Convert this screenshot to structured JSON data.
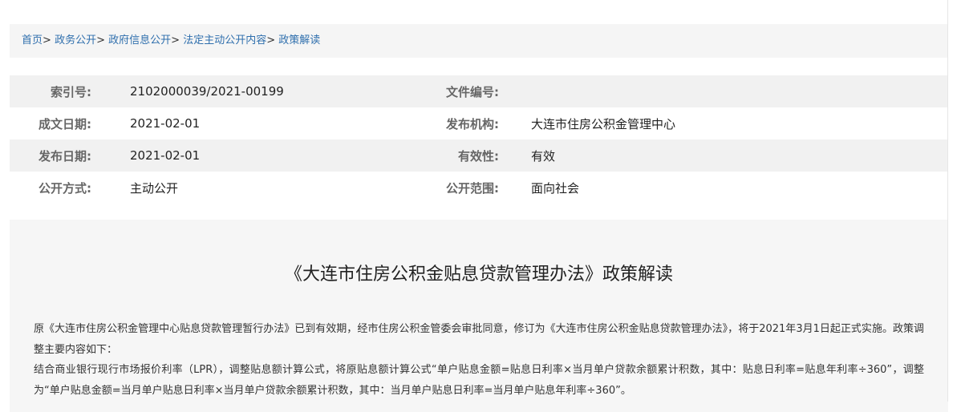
{
  "breadcrumb": {
    "items": [
      "首页",
      "政务公开",
      "政府信息公开",
      "法定主动公开内容",
      "政策解读"
    ],
    "separator": ">"
  },
  "meta": {
    "rows": [
      {
        "label1": "索引号:",
        "value1": "2102000039/2021-00199",
        "label2": "文件编号:",
        "value2": ""
      },
      {
        "label1": "成文日期:",
        "value1": "2021-02-01",
        "label2": "发布机构:",
        "value2": "大连市住房公积金管理中心"
      },
      {
        "label1": "发布日期:",
        "value1": "2021-02-01",
        "label2": "有效性:",
        "value2": "有效"
      },
      {
        "label1": "公开方式:",
        "value1": "主动公开",
        "label2": "公开范围:",
        "value2": "面向社会"
      }
    ]
  },
  "article": {
    "title": "《大连市住房公积金贴息贷款管理办法》政策解读",
    "paragraphs": [
      "原《大连市住房公积金管理中心贴息贷款管理暂行办法》已到有效期，经市住房公积金管委会审批同意，修订为《大连市住房公积金贴息贷款管理办法》，将于2021年3月1日起正式实施。政策调整主要内容如下：",
      "结合商业银行现行市场报价利率（LPR），调整贴息额计算公式，将原贴息额计算公式“单户贴息金额=贴息日利率×当月单户贷款余额累计积数，其中：贴息日利率=贴息年利率÷360”，调整为“单户贴息金额=当月单户贴息日利率×当月单户贷款余额累计积数，其中：当月单户贴息日利率=当月单户贴息年利率÷360”。"
    ]
  },
  "colors": {
    "link": "#2f6fad",
    "label": "#666666",
    "row_alt_bg": "#f1f1f1",
    "breadcrumb_bg": "#f5f5f5"
  }
}
